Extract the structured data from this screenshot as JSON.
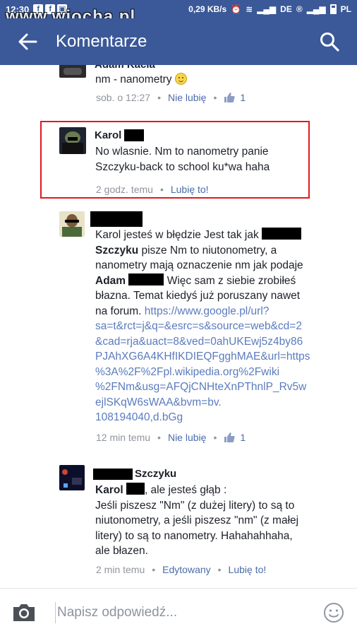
{
  "statusbar": {
    "time": "12:30",
    "speed": "0,29 KB/s",
    "network": "DE",
    "region": "PL",
    "watermark": "www.wiocha.pl"
  },
  "appbar": {
    "title": "Komentarze"
  },
  "comments": [
    {
      "author": "Adam Kacia",
      "text": "nm - nanometry",
      "time": "sob. o 12:27",
      "action": "Nie lubię",
      "likes": "1"
    },
    {
      "author": "Karol",
      "text_line1": "No wlasnie. Nm to nanometry panie",
      "text_line2": "Szczyku-back to school ku*wa haha",
      "time": "2 godz. temu",
      "action": "Lubię to!"
    },
    {
      "l1": "Karol jesteś w błędzie Jest tak jak",
      "l2_bold": "Szczyku",
      "l2_rest": " pisze Nm to niutonometry, a",
      "l3": "nanometry mają oznaczenie nm jak podaje",
      "l4_bold": "Adam",
      "l4_rest": " Więc sam z siebie zrobiłeś",
      "l5": "błazna. Temat kiedyś już poruszany nawet",
      "l6_text": "na forum. ",
      "url_lines": [
        "https://www.google.pl/url?",
        "sa=t&rct=j&q=&esrc=s&source=web&cd=2",
        "&cad=rja&uact=8&ved=0ahUKEwj5z4by86",
        "PJAhXG6A4KHfIKDIEQFgghMAE&url=https",
        "%3A%2F%2Fpl.wikipedia.org%2Fwiki",
        "%2FNm&usg=AFQjCNHteXnPThnlP_Rv5w",
        "ejlSKqW6sWAA&bvm=bv.",
        "108194040,d.bGg"
      ],
      "time": "12 min temu",
      "action": "Nie lubię",
      "likes": "1"
    },
    {
      "author_suffix": "Szczyku",
      "mention": "Karol",
      "l1_rest": ", ale jesteś głąb :",
      "l2": "Jeśli piszesz \"Nm\" (z dużej litery) to są to",
      "l3": "niutonometry, a jeśli piszesz \"nm\" (z małej",
      "l4": "litery) to są to nanometry. Hahahahhaha,",
      "l5": "ale błazen.",
      "time": "2 min temu",
      "edited": "Edytowany",
      "action": "Lubię to!"
    }
  ],
  "composer": {
    "placeholder": "Napisz odpowiedź..."
  },
  "colors": {
    "brand": "#3b5998",
    "link": "#4b6ba8",
    "highlight": "#e0191f"
  }
}
